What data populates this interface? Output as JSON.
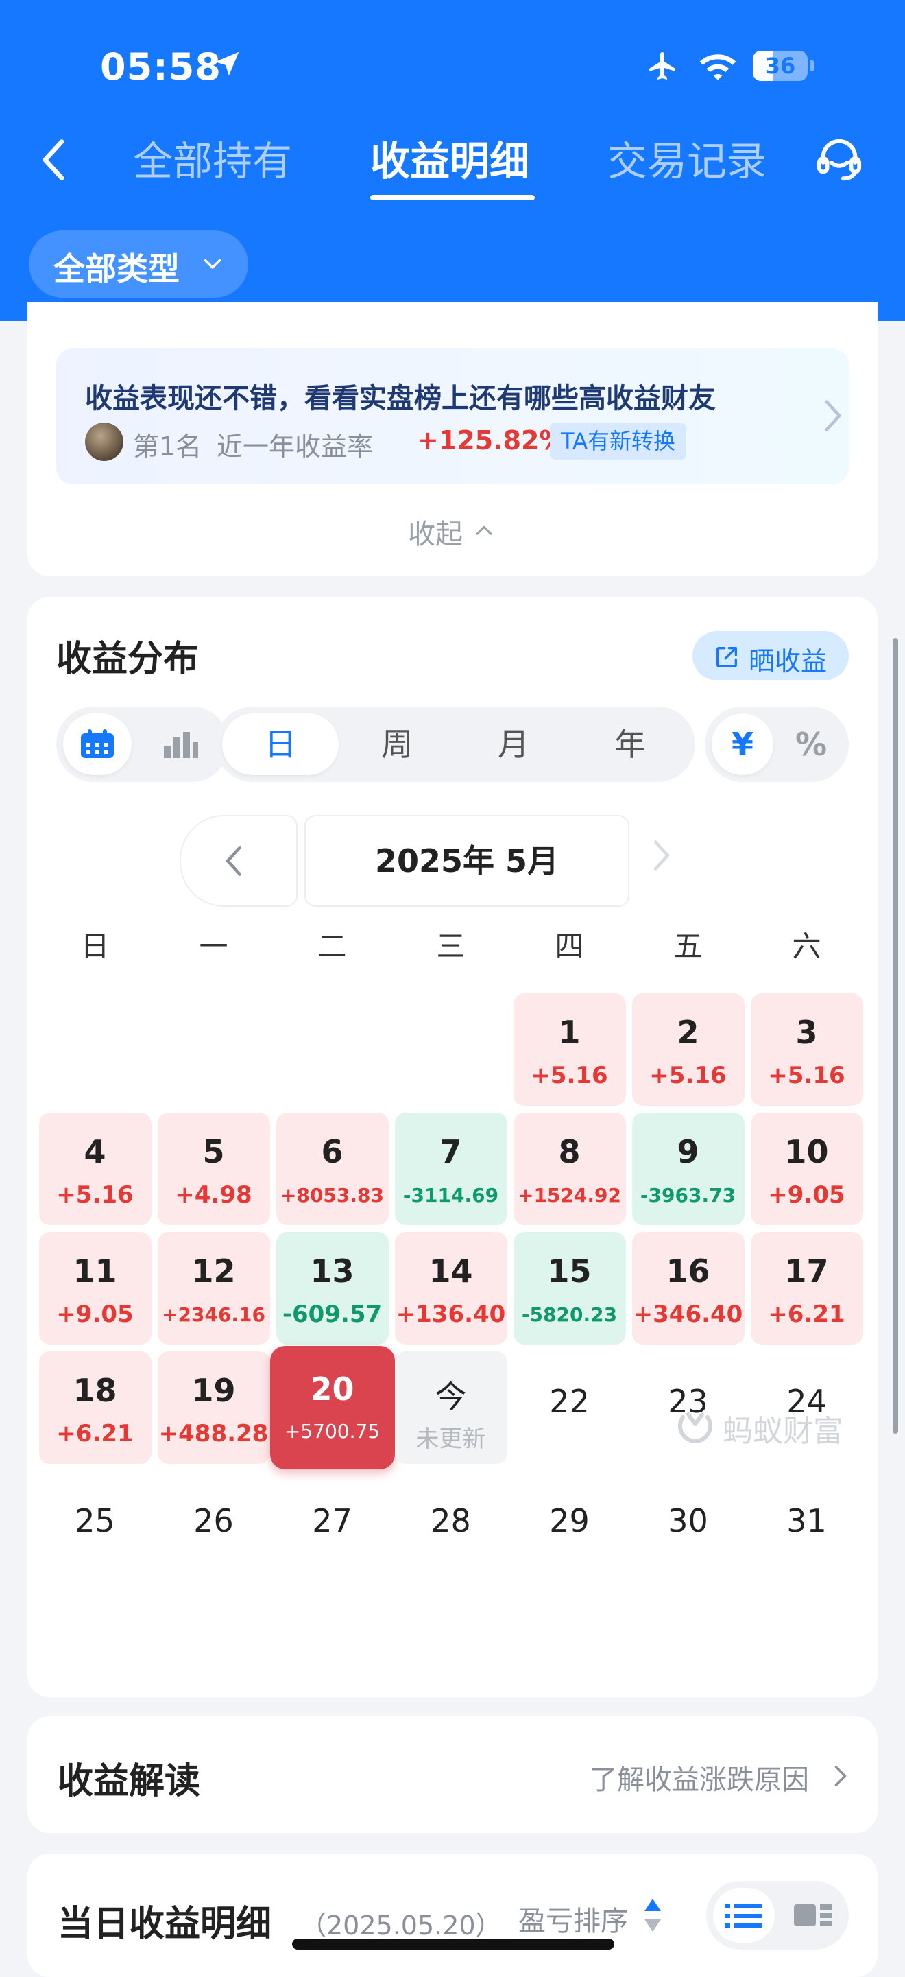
{
  "status": {
    "time": "05:58",
    "battery": "36",
    "battery_level": 0.36
  },
  "nav": {
    "tabs": [
      {
        "label": "全部持有"
      },
      {
        "label": "收益明细"
      },
      {
        "label": "交易记录"
      }
    ],
    "type_filter": "全部类型"
  },
  "banner": {
    "title": "收益表现还不错，看看实盘榜上还有哪些高收益财友",
    "rank": "第1名",
    "rate_label": "近一年收益率",
    "rate_value": "+125.82%",
    "badge": "TA有新转换",
    "collapse": "收起"
  },
  "distribution": {
    "title": "收益分布",
    "share": "晒收益",
    "periods": [
      "日",
      "周",
      "月",
      "年"
    ],
    "selected_period": "日",
    "units": [
      "¥",
      "%"
    ],
    "month": "2025年 5月",
    "weekdays": [
      "日",
      "一",
      "二",
      "三",
      "四",
      "五",
      "六"
    ],
    "days": [
      {
        "d": "1",
        "v": "+5.16",
        "t": "pos"
      },
      {
        "d": "2",
        "v": "+5.16",
        "t": "pos"
      },
      {
        "d": "3",
        "v": "+5.16",
        "t": "pos"
      },
      {
        "d": "4",
        "v": "+5.16",
        "t": "pos"
      },
      {
        "d": "5",
        "v": "+4.98",
        "t": "pos"
      },
      {
        "d": "6",
        "v": "+8053.83",
        "t": "pos"
      },
      {
        "d": "7",
        "v": "-3114.69",
        "t": "neg"
      },
      {
        "d": "8",
        "v": "+1524.92",
        "t": "pos"
      },
      {
        "d": "9",
        "v": "-3963.73",
        "t": "neg"
      },
      {
        "d": "10",
        "v": "+9.05",
        "t": "pos"
      },
      {
        "d": "11",
        "v": "+9.05",
        "t": "pos"
      },
      {
        "d": "12",
        "v": "+2346.16",
        "t": "pos"
      },
      {
        "d": "13",
        "v": "-609.57",
        "t": "neg"
      },
      {
        "d": "14",
        "v": "+136.40",
        "t": "pos"
      },
      {
        "d": "15",
        "v": "-5820.23",
        "t": "neg"
      },
      {
        "d": "16",
        "v": "+346.40",
        "t": "pos"
      },
      {
        "d": "17",
        "v": "+6.21",
        "t": "pos"
      },
      {
        "d": "18",
        "v": "+6.21",
        "t": "pos"
      },
      {
        "d": "19",
        "v": "+488.28",
        "t": "pos"
      },
      {
        "d": "20",
        "v": "+5700.75",
        "t": "selected"
      },
      {
        "d": "今",
        "v": "未更新",
        "t": "today"
      },
      {
        "d": "22",
        "v": "",
        "t": "blank"
      },
      {
        "d": "23",
        "v": "",
        "t": "blank"
      },
      {
        "d": "24",
        "v": "",
        "t": "blank"
      },
      {
        "d": "25",
        "v": "",
        "t": "blank"
      },
      {
        "d": "26",
        "v": "",
        "t": "blank"
      },
      {
        "d": "27",
        "v": "",
        "t": "blank"
      },
      {
        "d": "28",
        "v": "",
        "t": "blank"
      },
      {
        "d": "29",
        "v": "",
        "t": "blank"
      },
      {
        "d": "30",
        "v": "",
        "t": "blank"
      },
      {
        "d": "31",
        "v": "",
        "t": "blank"
      }
    ],
    "watermark": "蚂蚁财富"
  },
  "reading": {
    "title": "收益解读",
    "link": "了解收益涨跌原因"
  },
  "daily": {
    "title": "当日收益明细",
    "date": "（2025.05.20）",
    "sort": "盈亏排序"
  },
  "colors": {
    "brand": "#1677ff",
    "gain": "#e53935",
    "loss": "#10996a",
    "selected": "#d9444f"
  }
}
